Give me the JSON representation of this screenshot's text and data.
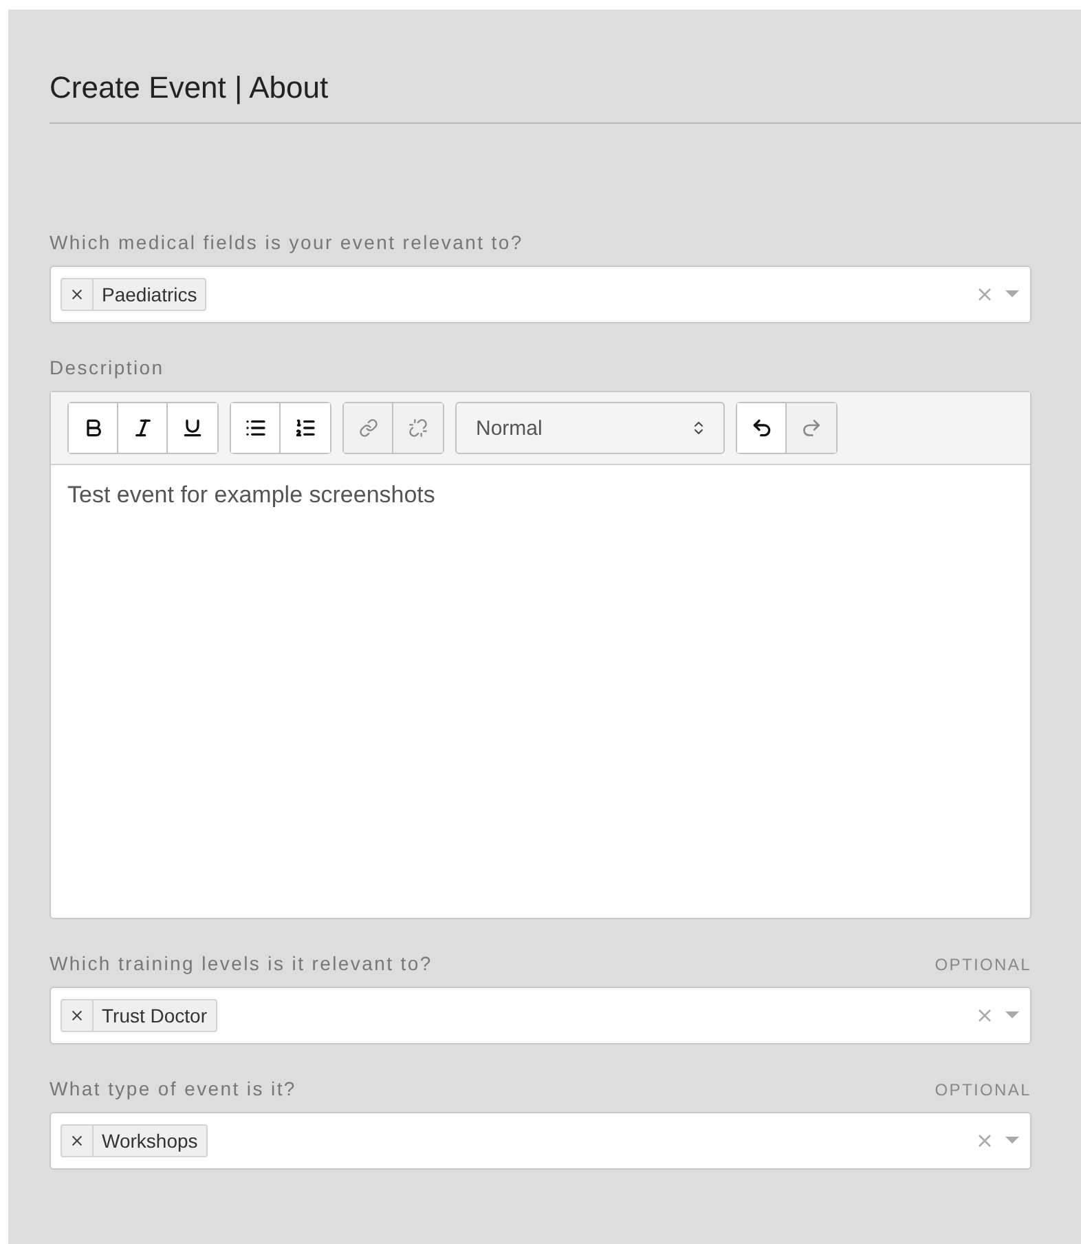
{
  "title": "Create Event | About",
  "fields": [
    {
      "kind": "select",
      "label": "Which medical fields is your event relevant to?",
      "tags": [
        "Paediatrics"
      ]
    },
    {
      "kind": "editor",
      "label": "Description",
      "format": "Normal",
      "text": "Test event for example screenshots"
    },
    {
      "kind": "select",
      "label": "Which training levels is it relevant to?",
      "optional": "OPTIONAL",
      "tags": [
        "Trust Doctor"
      ]
    },
    {
      "kind": "select",
      "label": "What type of event is it?",
      "optional": "OPTIONAL",
      "tags": [
        "Workshops"
      ]
    }
  ]
}
